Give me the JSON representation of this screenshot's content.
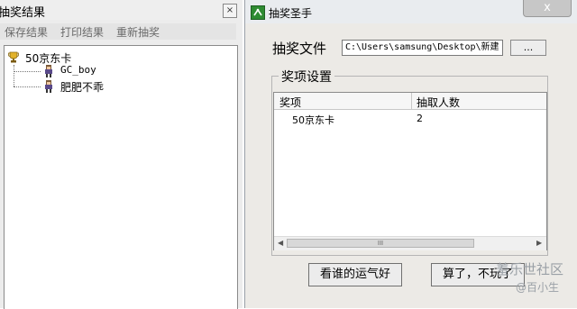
{
  "left_window": {
    "title": "抽奖结果",
    "close_glyph": "×",
    "menu": [
      "保存结果",
      "打印结果",
      "重新抽奖"
    ],
    "tree": {
      "root": "50京东卡",
      "children": [
        "GC_boy",
        "肥肥不乖"
      ]
    }
  },
  "right_window": {
    "title": "抽奖圣手",
    "close_glyph": "x",
    "file_label": "抽奖文件",
    "file_path": "C:\\Users\\samsung\\Desktop\\新建",
    "browse_label": "...",
    "group_title": "奖项设置",
    "columns": [
      "奖项",
      "抽取人数"
    ],
    "rows": [
      {
        "prize": "50京东卡",
        "count": "2"
      }
    ],
    "scroll_thumb_glyph": "III",
    "scroll_left_glyph": "◀",
    "scroll_right_glyph": "▶",
    "buttons": {
      "go": "看谁的运气好",
      "quit": "算了，不玩了"
    }
  },
  "watermark": {
    "line1": "羞乐世社区",
    "line2": "@百小生"
  },
  "colors": {
    "app_icon_green": "#2e8b32",
    "menu_text_gray": "#6a6a6a"
  }
}
